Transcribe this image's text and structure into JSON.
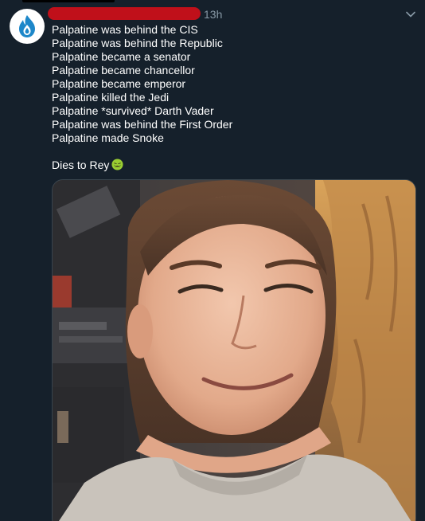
{
  "tweet": {
    "timestamp": "13h",
    "lines": [
      "Palpatine was behind the CIS",
      "Palpatine was behind the Republic",
      "Palpatine became a senator",
      "Palpatine became chancellor",
      "Palpatine became emperor",
      "Palpatine killed the Jedi",
      "Palpatine *survived* Darth Vader",
      "Palpatine was behind the First Order",
      "Palpatine made Snoke"
    ],
    "closing_text": "Dies to Rey",
    "closing_emoji": "nauseated-face-emoji"
  },
  "icons": {
    "avatar": "flame-logo-icon",
    "menu": "chevron-down-icon"
  },
  "colors": {
    "background": "#15202b",
    "secondary_text": "#8899a6",
    "redaction": "#c0101a",
    "avatar_flame": "#1d87c9"
  }
}
